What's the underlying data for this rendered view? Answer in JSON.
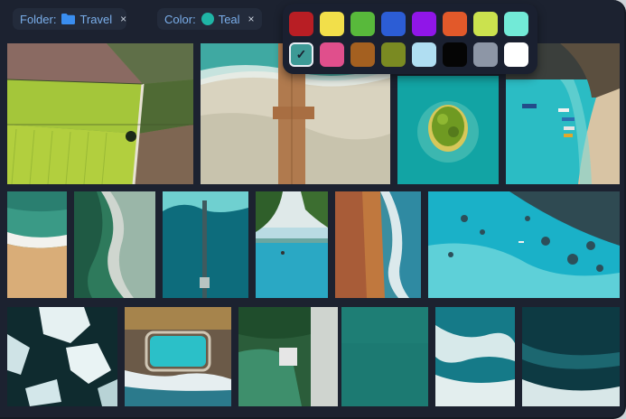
{
  "filters": {
    "folder": {
      "label": "Folder:",
      "value": "Travel",
      "remove": "×"
    },
    "color": {
      "label": "Color:",
      "value": "Teal",
      "remove": "×",
      "dot_color": "#1fb5a6"
    }
  },
  "palette": {
    "selected": "teal",
    "swatches": [
      {
        "name": "red",
        "color": "#b81e24"
      },
      {
        "name": "yellow",
        "color": "#f2df4a"
      },
      {
        "name": "green",
        "color": "#58b93b"
      },
      {
        "name": "blue",
        "color": "#2c5dd5"
      },
      {
        "name": "purple",
        "color": "#9016e8"
      },
      {
        "name": "orange",
        "color": "#e2592a"
      },
      {
        "name": "lime",
        "color": "#cbe24e"
      },
      {
        "name": "aqua",
        "color": "#72ead7"
      },
      {
        "name": "teal",
        "color": "#3d9a96",
        "check": "✓"
      },
      {
        "name": "pink",
        "color": "#e04f8c"
      },
      {
        "name": "brown",
        "color": "#a46020"
      },
      {
        "name": "olive",
        "color": "#7a8a22"
      },
      {
        "name": "light-blue",
        "color": "#b0def2"
      },
      {
        "name": "black",
        "color": "#050505"
      },
      {
        "name": "gray",
        "color": "#8d96a6"
      },
      {
        "name": "white",
        "color": "#ffffff"
      }
    ]
  },
  "gallery": {
    "photos": [
      {
        "name": "photo-farm-fields",
        "kind": "fields"
      },
      {
        "name": "photo-beach-pier",
        "kind": "pier"
      },
      {
        "name": "photo-island",
        "kind": "island"
      },
      {
        "name": "photo-boats-cove",
        "kind": "boats"
      },
      {
        "name": "photo-shoreline-sand",
        "kind": "sandwave"
      },
      {
        "name": "photo-green-coast",
        "kind": "greencoast"
      },
      {
        "name": "photo-jetty",
        "kind": "jetty"
      },
      {
        "name": "photo-infinity-pool",
        "kind": "infinity"
      },
      {
        "name": "photo-red-cliffs",
        "kind": "cliffs"
      },
      {
        "name": "photo-reef-lagoon",
        "kind": "reef"
      },
      {
        "name": "photo-ice-floes",
        "kind": "ice"
      },
      {
        "name": "photo-rock-pool",
        "kind": "rockpool"
      },
      {
        "name": "photo-forest-road",
        "kind": "forest"
      },
      {
        "name": "photo-calm-sea",
        "kind": "calm"
      },
      {
        "name": "photo-surf-foam",
        "kind": "surf"
      },
      {
        "name": "photo-dark-waves",
        "kind": "darkwave"
      }
    ]
  }
}
